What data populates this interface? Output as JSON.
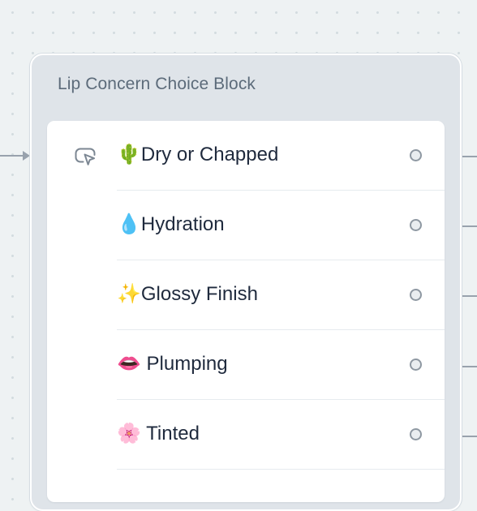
{
  "block": {
    "title": "Lip Concern Choice Block",
    "icon": "cursor-click-icon"
  },
  "choices": [
    {
      "label": "🌵Dry or Chapped"
    },
    {
      "label": "💧Hydration"
    },
    {
      "label": "✨Glossy Finish"
    },
    {
      "label": "👄 Plumping"
    },
    {
      "label": "🌸 Tinted"
    }
  ],
  "colors": {
    "canvas": "#eef2f3",
    "block_bg": "#dfe4e9",
    "title": "#5c6b7a",
    "label": "#1f2a3d",
    "edge": "#98a2ad"
  }
}
